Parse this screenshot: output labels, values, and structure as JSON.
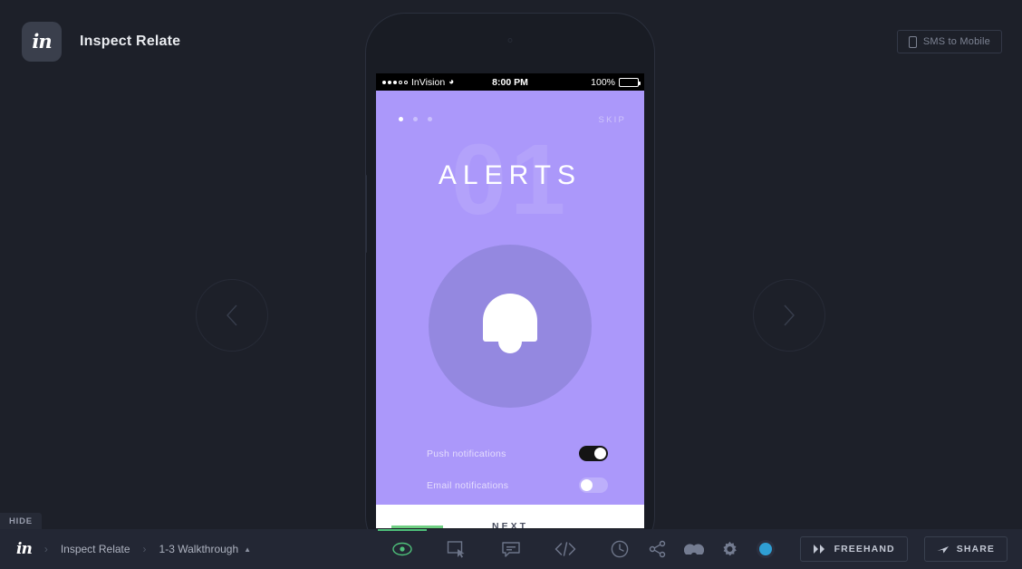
{
  "header": {
    "logo_text": "in",
    "title": "Inspect Relate",
    "sms_button": {
      "label": "SMS to Mobile",
      "icon": "mobile-phone-icon"
    }
  },
  "navigation": {
    "prev_icon": "chevron-left-icon",
    "next_icon": "chevron-right-icon"
  },
  "device": {
    "status_bar": {
      "carrier": "InVision",
      "signal_dots_filled": 3,
      "signal_dots_empty": 2,
      "wifi_icon": "wifi-icon",
      "time": "8:00 PM",
      "battery_percent": "100%",
      "battery_icon": "battery-full-icon"
    },
    "screen": {
      "pagination_dots": 3,
      "pagination_active_index": 0,
      "skip_label": "SKIP",
      "watermark_number": "01",
      "title": "ALERTS",
      "hero_icon": "bell-icon",
      "settings": [
        {
          "label": "Push notifications",
          "state": "on"
        },
        {
          "label": "Email notifications",
          "state": "off"
        }
      ],
      "next_label": "NEXT",
      "colors": {
        "background": "#ab98fa",
        "circle": "#9488e0",
        "accent_green": "#6fcf82"
      }
    }
  },
  "bottom_bar": {
    "hide_tab_label": "HIDE",
    "breadcrumb": {
      "logo_text": "in",
      "items": [
        {
          "label": "Inspect Relate"
        },
        {
          "label": "1-3 Walkthrough"
        }
      ],
      "separator": "›",
      "caret": "▲"
    },
    "tools": [
      {
        "name": "preview-eye",
        "icon": "eye-icon",
        "active": true
      },
      {
        "name": "build-hotspot",
        "icon": "rectangle-cursor-icon",
        "active": false
      },
      {
        "name": "comments",
        "icon": "comment-icon",
        "active": false
      },
      {
        "name": "inspect-code",
        "icon": "code-icon",
        "active": false
      },
      {
        "name": "history",
        "icon": "clock-icon",
        "active": false
      }
    ],
    "right_actions": {
      "icons": [
        {
          "name": "share-network",
          "icon": "share-network-icon"
        },
        {
          "name": "sync-cloud",
          "icon": "cloud-icon"
        },
        {
          "name": "settings",
          "icon": "gear-icon"
        }
      ],
      "avatar": {
        "icon": "user-avatar",
        "color": "#2f9fd4"
      },
      "freehand_button": {
        "label": "FREEHAND",
        "icon": "freehand-icon"
      },
      "share_button": {
        "label": "SHARE",
        "icon": "share-arrow-icon"
      }
    }
  },
  "theme": {
    "page_background": "#1d2029",
    "bar_background": "#232734",
    "accent_green": "#4ec07a",
    "accent_blue": "#2f9fd4"
  }
}
